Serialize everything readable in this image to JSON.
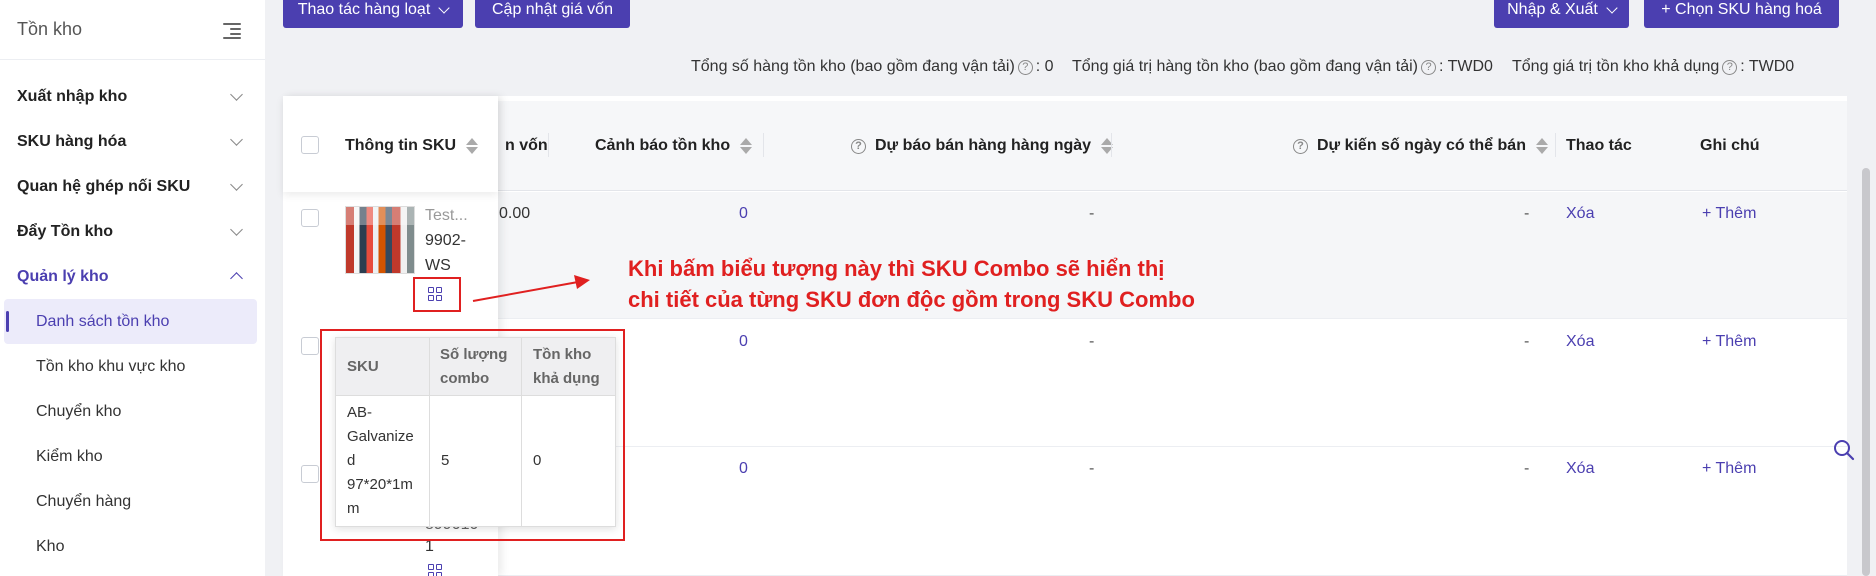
{
  "sidebar": {
    "title": "Tồn kho",
    "items": [
      {
        "label": "Xuất nhập kho"
      },
      {
        "label": "SKU hàng hóa"
      },
      {
        "label": "Quan hệ ghép nối SKU"
      },
      {
        "label": "Đẩy Tồn kho"
      },
      {
        "label": "Quản lý kho"
      }
    ],
    "subitems": [
      {
        "label": "Danh sách tồn kho"
      },
      {
        "label": "Tồn kho khu vực kho"
      },
      {
        "label": "Chuyển kho"
      },
      {
        "label": "Kiểm kho"
      },
      {
        "label": "Chuyển hàng"
      },
      {
        "label": "Kho"
      }
    ]
  },
  "toolbar": {
    "bulk_action": "Thao tác hàng loạt",
    "update_cost": "Cập nhật giá vốn",
    "import_export": "Nhập & Xuất",
    "choose_sku": "+ Chọn SKU hàng hoá"
  },
  "summary": {
    "total_stock_label": "Tổng số hàng tồn kho (bao gồm đang vận tải)",
    "total_stock_value": ": 0",
    "total_value_label": "Tổng giá trị hàng tồn kho (bao gồm đang vận tải)",
    "total_value_value": ": TWD0",
    "available_value_label": "Tổng giá trị tồn kho khả dụng",
    "available_value_value": ": TWD0"
  },
  "table": {
    "headers": {
      "sku_info": "Thông tin SKU",
      "cost_partial": "n vốn",
      "stock_warning": "Cảnh báo tồn kho",
      "daily_forecast": "Dự báo bán hàng hàng ngày",
      "days_sellable": "Dự kiến số ngày có thể bán",
      "actions": "Thao tác",
      "notes": "Ghi chú"
    },
    "rows": [
      {
        "cost": "0.00",
        "warning": "0",
        "forecast": "-",
        "days": "-",
        "delete": "Xóa",
        "add": "+ Thêm",
        "sku_name": "Test...",
        "sku_code_1": "9902-",
        "sku_code_2": "WS"
      },
      {
        "cost": "",
        "warning": "0",
        "forecast": "-",
        "days": "-",
        "delete": "Xóa",
        "add": "+ Thêm"
      },
      {
        "cost": "",
        "warning": "0",
        "forecast": "-",
        "days": "-",
        "delete": "Xóa",
        "add": "+ Thêm",
        "sku_code_1": "899010",
        "sku_code_2": "1"
      }
    ]
  },
  "annotation": {
    "line1": "Khi bấm biểu tượng này thì SKU Combo sẽ hiển thị",
    "line2": "chi tiết của từng SKU đơn độc gồm trong SKU Combo"
  },
  "combo_popup": {
    "headers": {
      "sku": "SKU",
      "qty_line1": "Số lượng",
      "qty_line2": "combo",
      "avail_line1": "Tồn kho",
      "avail_line2": "khả dụng"
    },
    "row": {
      "sku_lines": [
        "AB-",
        "Galvanize",
        "d",
        "97*20*1m",
        "m"
      ],
      "qty": "5",
      "avail": "0"
    }
  },
  "colors": {
    "accent": "#4b3fb0",
    "annotation_red": "#e02020"
  }
}
